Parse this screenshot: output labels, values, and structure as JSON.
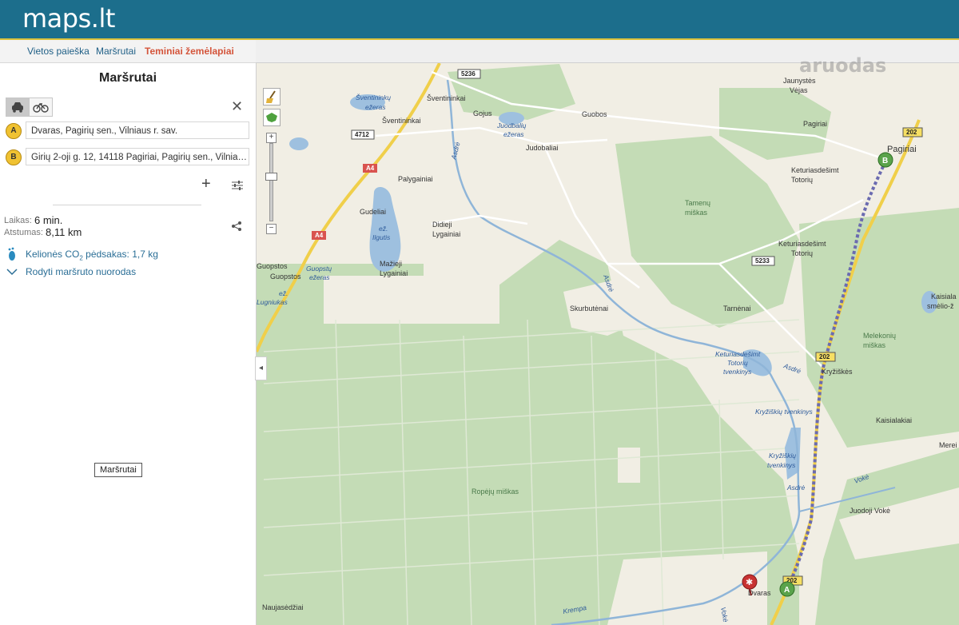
{
  "app": {
    "logo": "maps.lt",
    "watermark": "aruodas"
  },
  "nav": {
    "items": [
      "Vietos paieška",
      "Maršrutai",
      "Teminiai žemėlapiai"
    ]
  },
  "panel": {
    "title": "Maršrutai",
    "point_a": {
      "badge": "A",
      "value": "Dvaras, Pagirių sen., Vilniaus r. sav."
    },
    "point_b": {
      "badge": "B",
      "value": "Girių 2-oji g. 12, 14118 Pagiriai, Pagirių sen., Vilniaus r. sav."
    },
    "time_label": "Laikas:",
    "time_value": "6 min.",
    "distance_label": "Atstumas:",
    "distance_value": "8,11 km",
    "co2_text": "Kelionės CO",
    "co2_sub": "2",
    "co2_rest": " pėdsakas: 1,7 kg",
    "directions_link": "Rodyti maršruto nuorodas",
    "tooltip": "Maršrutai"
  },
  "map": {
    "labels": {
      "l1": "Jaunystės",
      "l2": "Vėjas",
      "l3": "Pagiriai",
      "l4": "Pagiriai",
      "l5": "Šventininkai",
      "l6": "Šventininkai",
      "l7": "Gojus",
      "l8": "Guobos",
      "l9": "Judobaliai",
      "l10": "Palygainiai",
      "l11": "Gudeliai",
      "l12": "Didieji",
      "l13": "Lygainiai",
      "l14": "Mažieji",
      "l15": "Lygainiai",
      "l16": "Guopstos",
      "l17": "Guopstos",
      "l18": "Keturiasdešimt",
      "l19": "Totorių",
      "l20": "Keturiasdešimt",
      "l21": "Totorių",
      "l22": "Skurbutėnai",
      "l23": "Tarnėnai",
      "l24": "Kryžiškės",
      "l25": "Kaisialakiai",
      "l26": "Juodoji Vokė",
      "l27": "Dvaras",
      "l28": "Naujasėdžiai",
      "l29": "Ropėjų miškas",
      "l30": "Tamenų",
      "l31": "miškas",
      "l32": "Melekonių",
      "l33": "miškas",
      "l34": "Kaisiala",
      "l35": "smėlio-ž",
      "l36": "Merei"
    },
    "water": {
      "w1": "Šventininkų",
      "w2": "ežeras",
      "w3": "Juodbalių",
      "w4": "ežeras",
      "w5": "ež.",
      "w6": "Ilgutis",
      "w7": "Guopstų",
      "w8": "ežeras",
      "w9": "ež.",
      "w10": "Lugniukas",
      "w11": "Asdrė",
      "w12": "Asdrė",
      "w13": "Keturiasdešimt",
      "w14": "Totorių",
      "w15": "tvenkinys",
      "w16": "Asdrė",
      "w17": "Kryžiškių tvenkinys",
      "w18": "Kryžiškių",
      "w19": "tvenkinys",
      "w20": "Asdrė",
      "w21": "Vokė",
      "w22": "Krempa",
      "w23": "Vokė"
    },
    "shields": {
      "s1": "5236",
      "s2": "4712",
      "s3": "A4",
      "s4": "A4",
      "s5": "5233",
      "s6": "202",
      "s7": "202",
      "s8": "202"
    },
    "markers": {
      "a": "A",
      "b": "B"
    }
  }
}
